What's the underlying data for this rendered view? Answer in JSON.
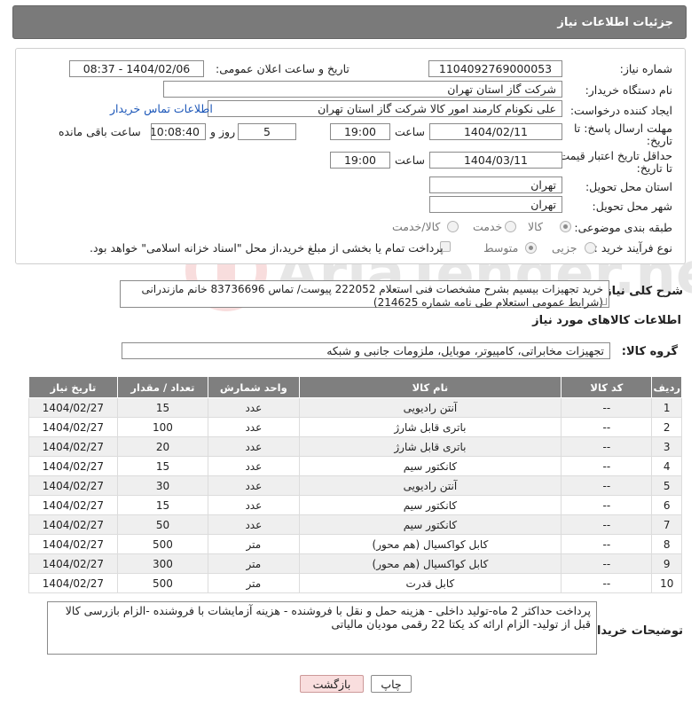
{
  "header": {
    "title": "جزئیات اطلاعات نیاز"
  },
  "fields": {
    "need_number_label": "شماره نیاز:",
    "need_number": "1104092769000053",
    "announce_label": "تاریخ و ساعت اعلان عمومی:",
    "announce_value": "1404/02/06 - 08:37",
    "buyer_org_label": "نام دستگاه خریدار:",
    "buyer_org": "شرکت گاز استان تهران",
    "creator_label": "ایجاد کننده درخواست:",
    "creator": "علی نکونام کارمند امور کالا شرکت گاز استان تهران",
    "buyer_contact_link": "اطلاعات تماس خریدار",
    "reply_deadline_label_1": "مهلت ارسال پاسخ: تا",
    "reply_deadline_label_2": "تاریخ:",
    "reply_date": "1404/02/11",
    "time_label": "ساعت",
    "reply_time": "19:00",
    "days_value": "5",
    "days_label": "روز و",
    "remaining_time": "10:08:40",
    "remaining_label": "ساعت باقی مانده",
    "validity_label_1": "حداقل تاریخ اعتبار قیمت:",
    "validity_label_2": "تا تاریخ:",
    "validity_date": "1404/03/11",
    "validity_time": "19:00",
    "province_label": "استان محل تحویل:",
    "province": "تهران",
    "city_label": "شهر محل تحویل:",
    "city": "تهران",
    "category_label": "طبقه بندی موضوعی:",
    "category_options": [
      "کالا",
      "خدمت",
      "کالا/خدمت"
    ],
    "category_selected": "کالا",
    "process_label": "نوع فرآیند خرید :",
    "process_options": [
      "جزیی",
      "متوسط"
    ],
    "process_selected": "متوسط",
    "payment_note": "پرداخت تمام یا بخشی از مبلغ خرید،از محل \"اسناد خزانه اسلامی\" خواهد بود."
  },
  "description": {
    "label": "شرح کلی نیاز:",
    "text": "خرید تجهیزات بیسیم بشرح مشخصات فنی استعلام 222052 پیوست/ تماس 83736696 خانم مازندرانی (شرایط عمومی استعلام طی نامه شماره 214625)"
  },
  "goods_info": {
    "section_title": "اطلاعات کالاهای مورد نیاز",
    "group_label": "گروه کالا:",
    "group_value": "تجهیزات مخابراتی، کامپیوتر، موبایل، ملزومات جانبی و شبکه"
  },
  "table": {
    "headers": [
      "ردیف",
      "کد کالا",
      "نام کالا",
      "واحد شمارش",
      "تعداد / مقدار",
      "تاریخ نیاز"
    ],
    "rows": [
      [
        "1",
        "--",
        "آنتن رادیویی",
        "عدد",
        "15",
        "1404/02/27"
      ],
      [
        "2",
        "--",
        "باتری قابل شارژ",
        "عدد",
        "100",
        "1404/02/27"
      ],
      [
        "3",
        "--",
        "باتری قابل شارژ",
        "عدد",
        "20",
        "1404/02/27"
      ],
      [
        "4",
        "--",
        "کانکتور سیم",
        "عدد",
        "15",
        "1404/02/27"
      ],
      [
        "5",
        "--",
        "آنتن رادیویی",
        "عدد",
        "30",
        "1404/02/27"
      ],
      [
        "6",
        "--",
        "کانکتور سیم",
        "عدد",
        "15",
        "1404/02/27"
      ],
      [
        "7",
        "--",
        "کانکتور سیم",
        "عدد",
        "50",
        "1404/02/27"
      ],
      [
        "8",
        "--",
        "کابل کواکسیال (هم محور)",
        "متر",
        "500",
        "1404/02/27"
      ],
      [
        "9",
        "--",
        "کابل کواکسیال (هم محور)",
        "متر",
        "300",
        "1404/02/27"
      ],
      [
        "10",
        "--",
        "کابل قدرت",
        "متر",
        "500",
        "1404/02/27"
      ]
    ]
  },
  "buyer_notes": {
    "label": "توضیحات خریدار:",
    "text": "پرداخت حداکثر 2 ماه-تولید داخلی - هزینه حمل و نقل با فروشنده - هزینه آزمایشات با فروشنده -الزام بازرسی کالا قبل از تولید- الزام ارائه کد یکتا 22 رقمی مودیان مالیاتی"
  },
  "buttons": {
    "print": "چاپ",
    "back": "بازگشت"
  },
  "watermark": {
    "text": "AriaTender.neT"
  },
  "colors": {
    "header_bg": "#7a7a7a",
    "table_header_bg": "#7f7f7f",
    "link": "#1b56b8",
    "back_button_bg": "#f9dede"
  }
}
